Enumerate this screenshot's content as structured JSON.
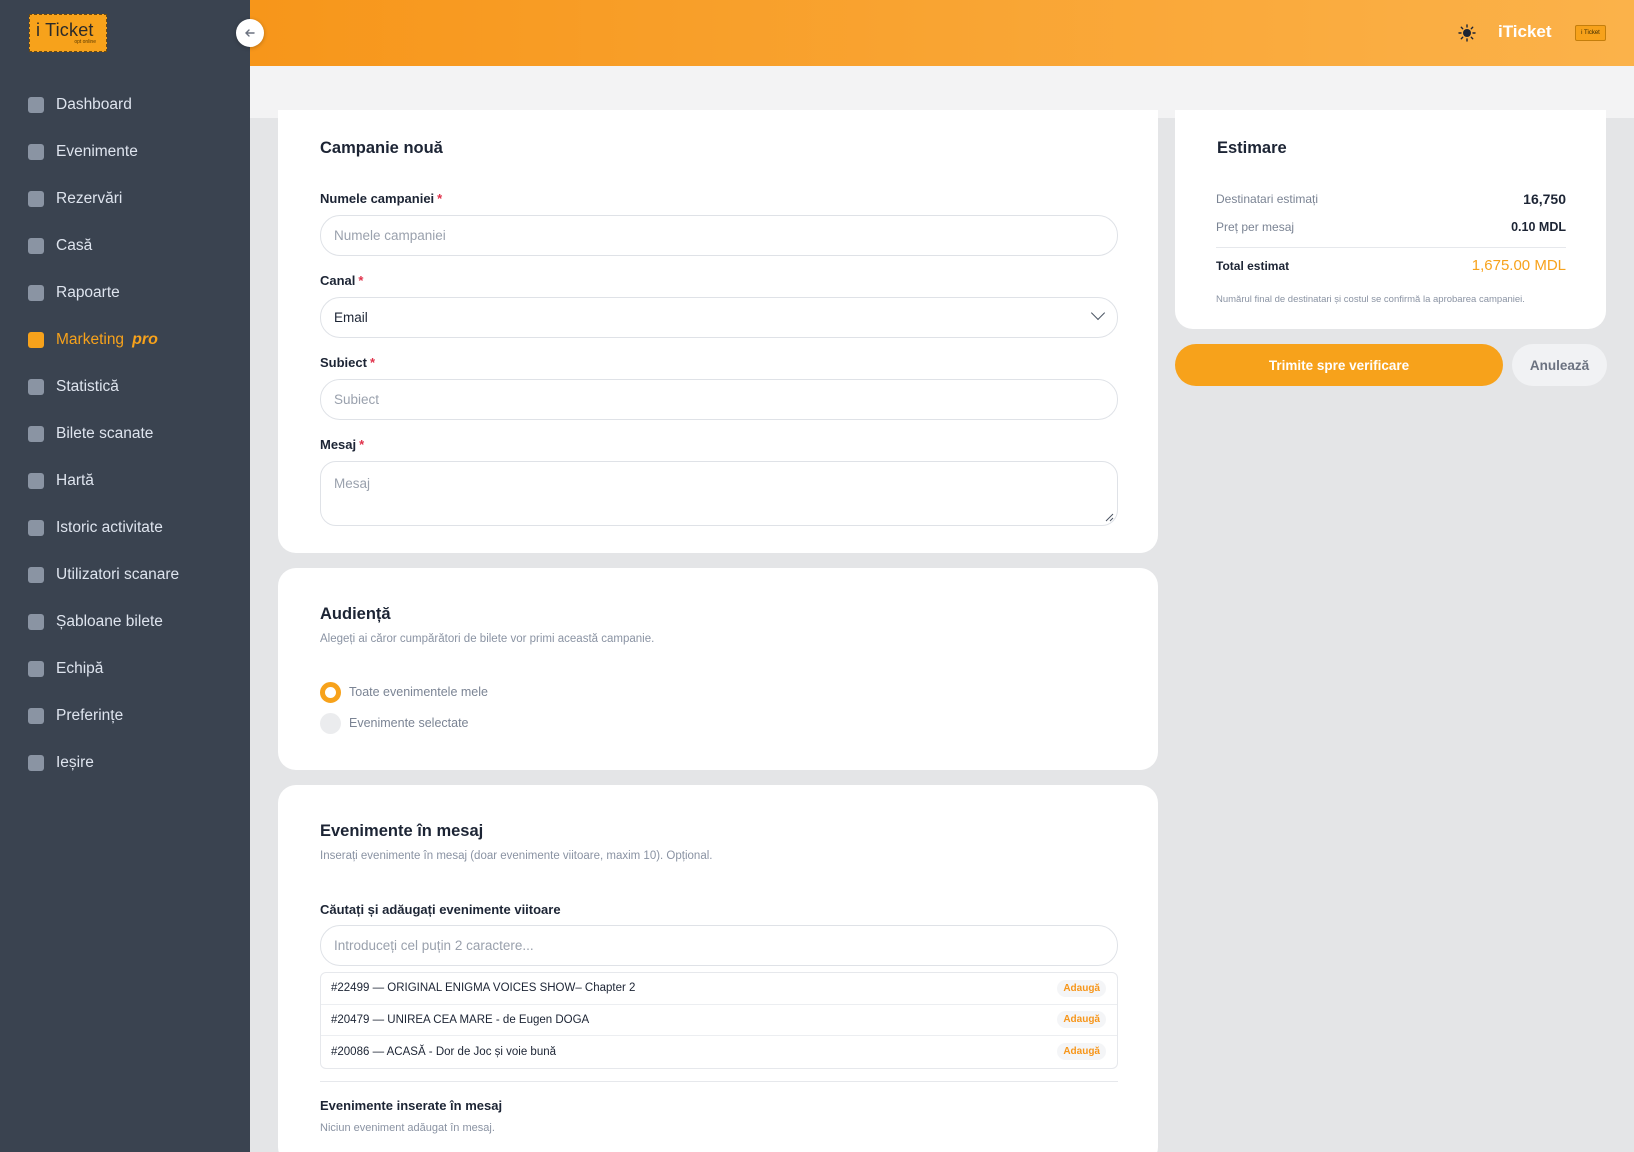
{
  "brand": {
    "logo_text": "i Ticket",
    "logo_sub": "opt online",
    "header_title": "iTicket",
    "avatar_text": "i Ticket"
  },
  "sidebar": {
    "items": [
      {
        "label": "Dashboard",
        "icon": "dashboard-icon"
      },
      {
        "label": "Evenimente",
        "icon": "calendar-icon"
      },
      {
        "label": "Rezervări",
        "icon": "reservations-icon"
      },
      {
        "label": "Casă",
        "icon": "cash-register-icon"
      },
      {
        "label": "Rapoarte",
        "icon": "reports-icon"
      },
      {
        "label": "Marketing",
        "icon": "mail-icon",
        "tag": "pro",
        "active": true
      },
      {
        "label": "Statistică",
        "icon": "chart-icon"
      },
      {
        "label": "Bilete scanate",
        "icon": "ticket-scan-icon"
      },
      {
        "label": "Hartă",
        "icon": "map-icon"
      },
      {
        "label": "Istoric activitate",
        "icon": "history-icon"
      },
      {
        "label": "Utilizatori scanare",
        "icon": "user-scan-icon"
      },
      {
        "label": "Șabloane bilete",
        "icon": "ticket-template-icon"
      },
      {
        "label": "Echipă",
        "icon": "team-icon"
      },
      {
        "label": "Preferințe",
        "icon": "preferences-icon"
      },
      {
        "label": "Ieșire",
        "icon": "logout-icon"
      }
    ]
  },
  "campaign": {
    "title": "Campanie nouă",
    "name_label": "Numele campaniei",
    "name_placeholder": "Numele campaniei",
    "channel_label": "Canal",
    "channel_value": "Email",
    "subject_label": "Subiect",
    "subject_placeholder": "Subiect",
    "message_label": "Mesaj",
    "message_placeholder": "Mesaj",
    "required_mark": "*"
  },
  "audience": {
    "title": "Audiență",
    "subtitle": "Alegeți ai căror cumpărători de bilete vor primi această campanie.",
    "options": [
      {
        "label": "Toate evenimentele mele",
        "selected": true
      },
      {
        "label": "Evenimente selectate",
        "selected": false
      }
    ]
  },
  "events": {
    "title": "Evenimente în mesaj",
    "subtitle": "Inserați evenimente în mesaj (doar evenimente viitoare, maxim 10). Opțional.",
    "search_label": "Căutați și adăugați evenimente viitoare",
    "search_placeholder": "Introduceți cel puțin 2 caractere...",
    "results": [
      {
        "text": "#22499 — ORIGINAL ENIGMA VOICES SHOW– Chapter 2",
        "action": "Adaugă"
      },
      {
        "text": "#20479 — UNIREA CEA MARE - de Eugen DOGA",
        "action": "Adaugă"
      },
      {
        "text": "#20086 — ACASĂ - Dor de Joc și voie bună",
        "action": "Adaugă"
      }
    ],
    "inserted_label": "Evenimente inserate în mesaj",
    "inserted_empty": "Niciun eveniment adăugat în mesaj."
  },
  "estimate": {
    "title": "Estimare",
    "recipients_label": "Destinatari estimați",
    "recipients_value": "16,750",
    "price_label": "Preț per mesaj",
    "price_value": "0.10 MDL",
    "total_label": "Total estimat",
    "total_value": "1,675.00 MDL",
    "note": "Numărul final de destinatari și costul se confirmă la aprobarea campaniei."
  },
  "actions": {
    "submit_label": "Trimite spre verificare",
    "cancel_label": "Anulează"
  },
  "colors": {
    "accent": "#f7a21b",
    "sidebar": "#3a4350",
    "required": "#e0324b"
  }
}
